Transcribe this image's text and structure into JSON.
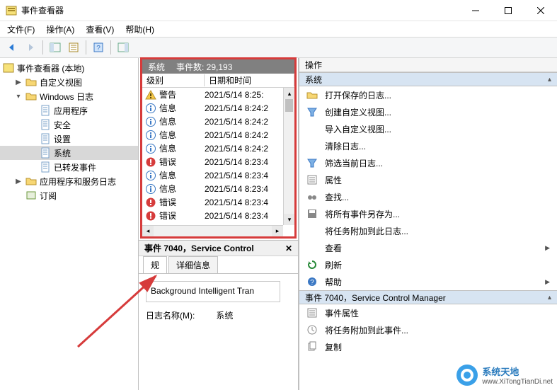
{
  "window": {
    "title": "事件查看器"
  },
  "menu": {
    "file": "文件(F)",
    "action": "操作(A)",
    "view": "查看(V)",
    "help": "帮助(H)"
  },
  "tree": {
    "root": "事件查看器 (本地)",
    "custom_views": "自定义视图",
    "windows_logs": "Windows 日志",
    "application": "应用程序",
    "security": "安全",
    "setup": "设置",
    "system": "系统",
    "forwarded": "已转发事件",
    "app_services": "应用程序和服务日志",
    "subscriptions": "订阅"
  },
  "list": {
    "header_left": "系统",
    "header_right": "事件数: 29,193",
    "col_level": "级别",
    "col_date": "日期和时间",
    "rows": [
      {
        "icon": "warning",
        "level": "警告",
        "date": "2021/5/14 8:25:"
      },
      {
        "icon": "info",
        "level": "信息",
        "date": "2021/5/14 8:24:2"
      },
      {
        "icon": "info",
        "level": "信息",
        "date": "2021/5/14 8:24:2"
      },
      {
        "icon": "info",
        "level": "信息",
        "date": "2021/5/14 8:24:2"
      },
      {
        "icon": "info",
        "level": "信息",
        "date": "2021/5/14 8:24:2"
      },
      {
        "icon": "error",
        "level": "错误",
        "date": "2021/5/14 8:23:4"
      },
      {
        "icon": "info",
        "level": "信息",
        "date": "2021/5/14 8:23:4"
      },
      {
        "icon": "info",
        "level": "信息",
        "date": "2021/5/14 8:23:4"
      },
      {
        "icon": "error",
        "level": "错误",
        "date": "2021/5/14 8:23:4"
      },
      {
        "icon": "error",
        "level": "错误",
        "date": "2021/5/14 8:23:4"
      }
    ]
  },
  "detail": {
    "title": "事件 7040，Service Control",
    "tab_general": "规",
    "tab_details": "详细信息",
    "desc": "Background Intelligent Tran",
    "log_name_label": "日志名称(M):",
    "log_name_value": "系统"
  },
  "actions": {
    "pane_title": "操作",
    "section_system": "系统",
    "open_saved": "打开保存的日志...",
    "create_view": "创建自定义视图...",
    "import_view": "导入自定义视图...",
    "clear_log": "清除日志...",
    "filter_log": "筛选当前日志...",
    "properties": "属性",
    "find": "查找...",
    "save_all": "将所有事件另存为...",
    "attach_task_log": "将任务附加到此日志...",
    "view": "查看",
    "refresh": "刷新",
    "help": "帮助",
    "section_event": "事件 7040，Service Control Manager",
    "event_props": "事件属性",
    "attach_task_event": "将任务附加到此事件...",
    "copy": "复制"
  },
  "watermark": {
    "line1": "系统天地",
    "line2": "www.XiTongTianDi.net"
  }
}
